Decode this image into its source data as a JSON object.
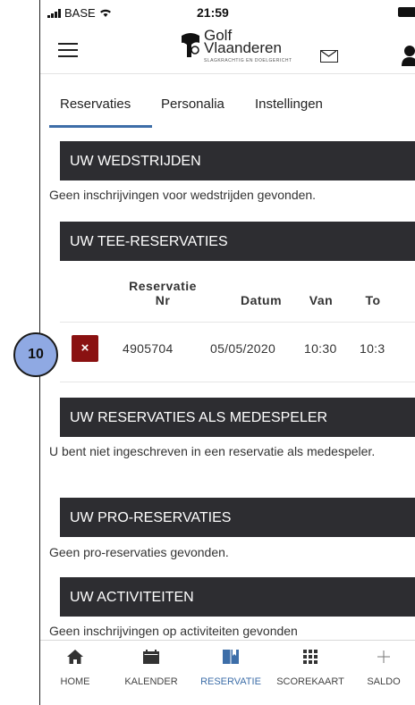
{
  "status_bar": {
    "carrier": "BASE",
    "time": "21:59"
  },
  "header": {
    "logo_line1": "Golf",
    "logo_line2": "Vlaanderen",
    "logo_tagline": "SLAGKRACHTIG EN DOELGERICHT"
  },
  "tabs": [
    {
      "label": "Reservaties",
      "active": true
    },
    {
      "label": "Personalia"
    },
    {
      "label": "Instellingen"
    }
  ],
  "sections": {
    "wedstrijden": {
      "title": "UW WEDSTRIJDEN",
      "note": "Geen inschrijvingen voor wedstrijden gevonden."
    },
    "tee": {
      "title": "UW TEE-RESERVATIES",
      "columns": [
        "Reservatie Nr",
        "Datum",
        "Van",
        "To"
      ],
      "rows": [
        {
          "nr": "4905704",
          "datum": "05/05/2020",
          "van": "10:30",
          "tot": "10:3"
        }
      ]
    },
    "medespeler": {
      "title": "UW RESERVATIES ALS MEDESPELER",
      "note": "U bent niet ingeschreven in een reservatie als medespeler."
    },
    "pro": {
      "title": "UW PRO-RESERVATIES",
      "note": "Geen pro-reservaties gevonden."
    },
    "activiteiten": {
      "title": "UW ACTIVITEITEN",
      "note": "Geen inschrijvingen op activiteiten gevonden"
    }
  },
  "delete_symbol": "×",
  "callout": "10",
  "bottom_nav": [
    {
      "label": "HOME",
      "icon": "home-icon"
    },
    {
      "label": "KALENDER",
      "icon": "calendar-icon"
    },
    {
      "label": "RESERVATIE",
      "icon": "book-icon",
      "active": true
    },
    {
      "label": "SCOREKAART",
      "icon": "grid-icon"
    },
    {
      "label": "SALDO",
      "icon": "plus-icon"
    }
  ],
  "colors": {
    "section_bg": "#2d2d31",
    "accent": "#3d6ea8",
    "delete_bg": "#8a1111",
    "callout_bg": "#8fa9e3"
  }
}
